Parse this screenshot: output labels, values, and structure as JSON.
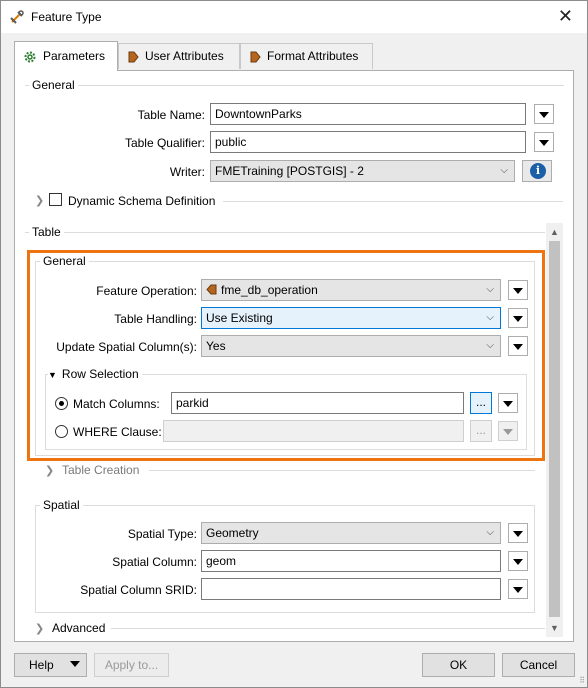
{
  "window": {
    "title": "Feature Type"
  },
  "tabs": [
    {
      "label": "Parameters"
    },
    {
      "label": "User Attributes"
    },
    {
      "label": "Format Attributes"
    }
  ],
  "general": {
    "legend": "General",
    "table_name_label": "Table Name:",
    "table_name_value": "DowntownParks",
    "table_qualifier_label": "Table Qualifier:",
    "table_qualifier_value": "public",
    "writer_label": "Writer:",
    "writer_value": "FMETraining [POSTGIS] - 2",
    "dynamic_schema_label": "Dynamic Schema Definition"
  },
  "table": {
    "legend": "Table",
    "general": {
      "legend": "General",
      "feature_operation_label": "Feature Operation:",
      "feature_operation_value": "fme_db_operation",
      "table_handling_label": "Table Handling:",
      "table_handling_value": "Use Existing",
      "update_spatial_label": "Update Spatial Column(s):",
      "update_spatial_value": "Yes",
      "row_selection": {
        "legend": "Row Selection",
        "match_columns_label": "Match Columns:",
        "match_columns_value": "parkid",
        "where_clause_label": "WHERE Clause:",
        "where_clause_value": "",
        "ellipsis": "..."
      }
    },
    "table_creation_label": "Table Creation",
    "spatial": {
      "legend": "Spatial",
      "spatial_type_label": "Spatial Type:",
      "spatial_type_value": "Geometry",
      "spatial_column_label": "Spatial Column:",
      "spatial_column_value": "geom",
      "spatial_srid_label": "Spatial Column SRID:",
      "spatial_srid_value": ""
    },
    "advanced_label": "Advanced"
  },
  "footer": {
    "help_label": "Help",
    "apply_label": "Apply to...",
    "ok_label": "OK",
    "cancel_label": "Cancel"
  },
  "colors": {
    "highlight": "#ee7412",
    "info": "#1b5fa7",
    "focus": "#0078d7"
  }
}
